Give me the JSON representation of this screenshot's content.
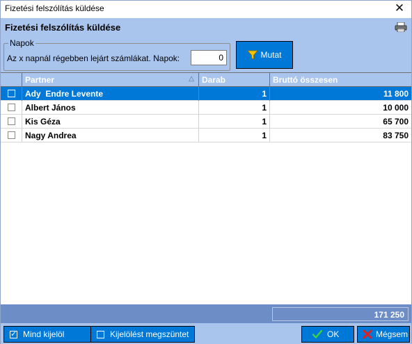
{
  "window": {
    "title": "Fizetési felszólítás küldése"
  },
  "header": {
    "title": "Fizetési felszólítás küldése"
  },
  "filter": {
    "group_label": "Napok",
    "label": "Az x napnál régebben lejárt számlákat. Napok:",
    "days_value": "0",
    "show_button": "Mutat"
  },
  "grid": {
    "columns": [
      "Partner",
      "Darab",
      "Bruttó összesen"
    ],
    "rows": [
      {
        "partner": "Ady  Endre Levente",
        "darab": "1",
        "brutto": "11 800",
        "selected": true
      },
      {
        "partner": "Albert János",
        "darab": "1",
        "brutto": "10 000",
        "selected": false
      },
      {
        "partner": "Kis Géza",
        "darab": "1",
        "brutto": "65 700",
        "selected": false
      },
      {
        "partner": "Nagy Andrea",
        "darab": "1",
        "brutto": "83 750",
        "selected": false
      }
    ],
    "total": "171 250"
  },
  "buttons": {
    "select_all": "Mind kijelöl",
    "clear_selection": "Kijelölést megszüntet",
    "ok": "OK",
    "cancel": "Mégsem"
  },
  "icons": {
    "print": "printer-icon",
    "filter": "funnel-icon",
    "ok": "check-icon",
    "cancel": "x-icon"
  },
  "colors": {
    "header_bg": "#a9c5ee",
    "selection": "#0078d7",
    "footer_band": "#6d8dc6"
  }
}
